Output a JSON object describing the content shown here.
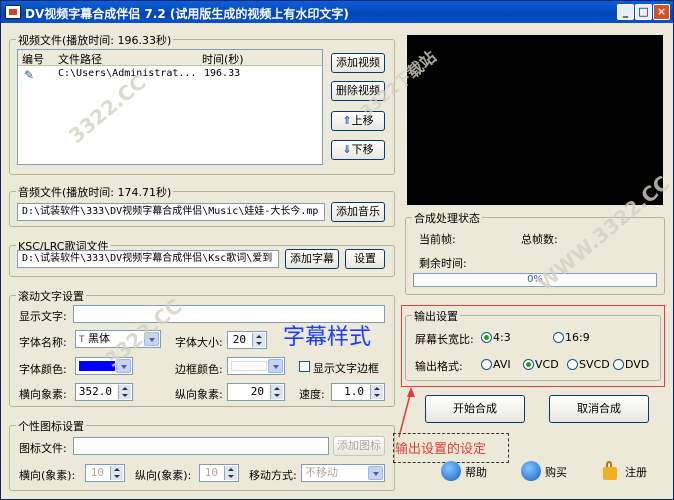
{
  "window": {
    "title": "DV视频字幕合成伴侣 7.2 (试用版生成的视频上有水印文字)",
    "minimize": "_",
    "maximize": "□",
    "close": "×"
  },
  "video_group": {
    "title": "视频文件(播放时间: 196.33秒)",
    "col_num": "编号",
    "col_path": "文件路径",
    "col_time": "时间(秒)",
    "row_path": "C:\\Users\\Administrat...",
    "row_time": "196.33",
    "add": "添加视频",
    "delete": "删除视频",
    "up": "上移",
    "down": "下移"
  },
  "audio_group": {
    "title": "音频文件(播放时间: 174.71秒)",
    "path": "D:\\试装软件\\333\\DV视频字幕合成伴侣\\Music\\娃娃-大长今.mp",
    "add": "添加音乐"
  },
  "ksc_group": {
    "title": "KSC/LRC歌词文件",
    "path": "D:\\试装软件\\333\\DV视频字幕合成伴侣\\Ksc歌词\\爱到",
    "add": "添加字幕",
    "settings": "设置"
  },
  "scroll_group": {
    "title": "滚动文字设置",
    "display_label": "显示文字:",
    "display_value": "",
    "font_name_label": "字体名称:",
    "font_name": "黑体",
    "font_size_label": "字体大小:",
    "font_size": "20",
    "font_color_label": "字体颜色:",
    "font_color": "#0000ff",
    "border_color_label": "边框颜色:",
    "border_color": "#ffffff",
    "show_border_label": "显示文字边框",
    "h_pixels_label": "横向象素:",
    "h_pixels": "352.0",
    "v_pixels_label": "纵向象素:",
    "v_pixels": "20",
    "speed_label": "速度:",
    "speed": "1.0",
    "style_caption": "字幕样式"
  },
  "logo_group": {
    "title": "个性图标设置",
    "icon_file_label": "图标文件:",
    "icon_file": "",
    "add_icon": "添加图标",
    "h_label": "横向(象素):",
    "h_value": "10",
    "v_label": "纵向(象素):",
    "v_value": "10",
    "move_label": "移动方式:",
    "move_value": "不移动"
  },
  "process_group": {
    "title": "合成处理状态",
    "current_frame": "当前帧:",
    "total_frames": "总帧数:",
    "remaining": "剩余时间:",
    "progress": "0%",
    "progress_value": 0
  },
  "output_group": {
    "title": "输出设置",
    "aspect_label": "屏幕长宽比:",
    "aspect_43": "4:3",
    "aspect_169": "16:9",
    "format_label": "输出格式:",
    "fmt_avi": "AVI",
    "fmt_vcd": "VCD",
    "fmt_svcd": "SVCD",
    "fmt_dvd": "DVD",
    "aspect_selected": "4:3",
    "format_selected": "VCD"
  },
  "actions": {
    "start": "开始合成",
    "cancel": "取消合成",
    "help": "帮助",
    "buy": "购买",
    "register": "注册"
  },
  "annotation": {
    "text": "输出设置的设定"
  },
  "watermarks": {
    "text": "3322.CC",
    "text2": "WWW.3322.CC",
    "text3": "3322下载站"
  },
  "colors": {
    "annotation": "#e23c3c",
    "highlight_box": "#e04040",
    "style_caption": "#1a3cff",
    "window_bg": "#ece9d8"
  }
}
